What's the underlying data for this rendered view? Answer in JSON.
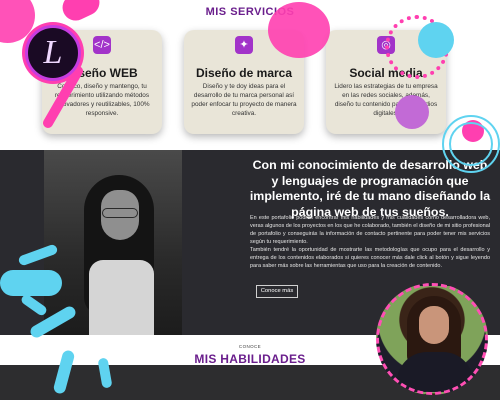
{
  "services": {
    "title": "MIS SERVICIOS",
    "cards": [
      {
        "icon": "code-icon",
        "icon_glyph": "</>",
        "title": "Diseño WEB",
        "text": "Codifico, diseño y mantengo, tu requerimiento utilizando métodos innovadores y reutilizables, 100% responsive."
      },
      {
        "icon": "lightbulb-icon",
        "icon_glyph": "✦",
        "title": "Diseño de marca",
        "text": "Diseño y te doy ideas para el desarrollo de tu marca personal así poder enfocar tu proyecto de manera creativa."
      },
      {
        "icon": "instagram-icon",
        "icon_glyph": "◎",
        "title": "Social media",
        "text": "Lidero las estrategias de tu empresa en las redes sociales, además, diseño tu contenido para los medios digitales."
      }
    ]
  },
  "intro": {
    "heading": "Con mi conocimiento de desarrollo web y lenguajes de programación que implemento, iré de tu mano diseñando la página web de tus sueños.",
    "paragraph_1": "En este portafolio podrás encontrar mis habilidades y mis cualidades como desarrolladora web, veras algunos de los proyectos en los que he colaborado, también el diseño de mi sitio profesional de portafolio y conseguirás la información de contacto pertinente para poder tener mis servicios según tu requerimiento.",
    "paragraph_2": "También tendré la oportunidad de mostrarte las metodologías que ocupo para el desarrollo y entrega de los contenidos elaborados si quieres conocer más dale click al botón y sigue leyendo para saber más sobre las herramientas que uso para la creación de contenido.",
    "button_label": "Conoce más"
  },
  "skills": {
    "subtitle": "CONOCE",
    "title": "MIS HABILIDADES"
  },
  "logo": {
    "letter": "L"
  },
  "colors": {
    "accent_purple": "#6a1e8c",
    "icon_purple": "#a233c9",
    "pink": "#ff3fb0",
    "cyan": "#5fd3f0",
    "dark_bg": "#2a2a2f"
  }
}
